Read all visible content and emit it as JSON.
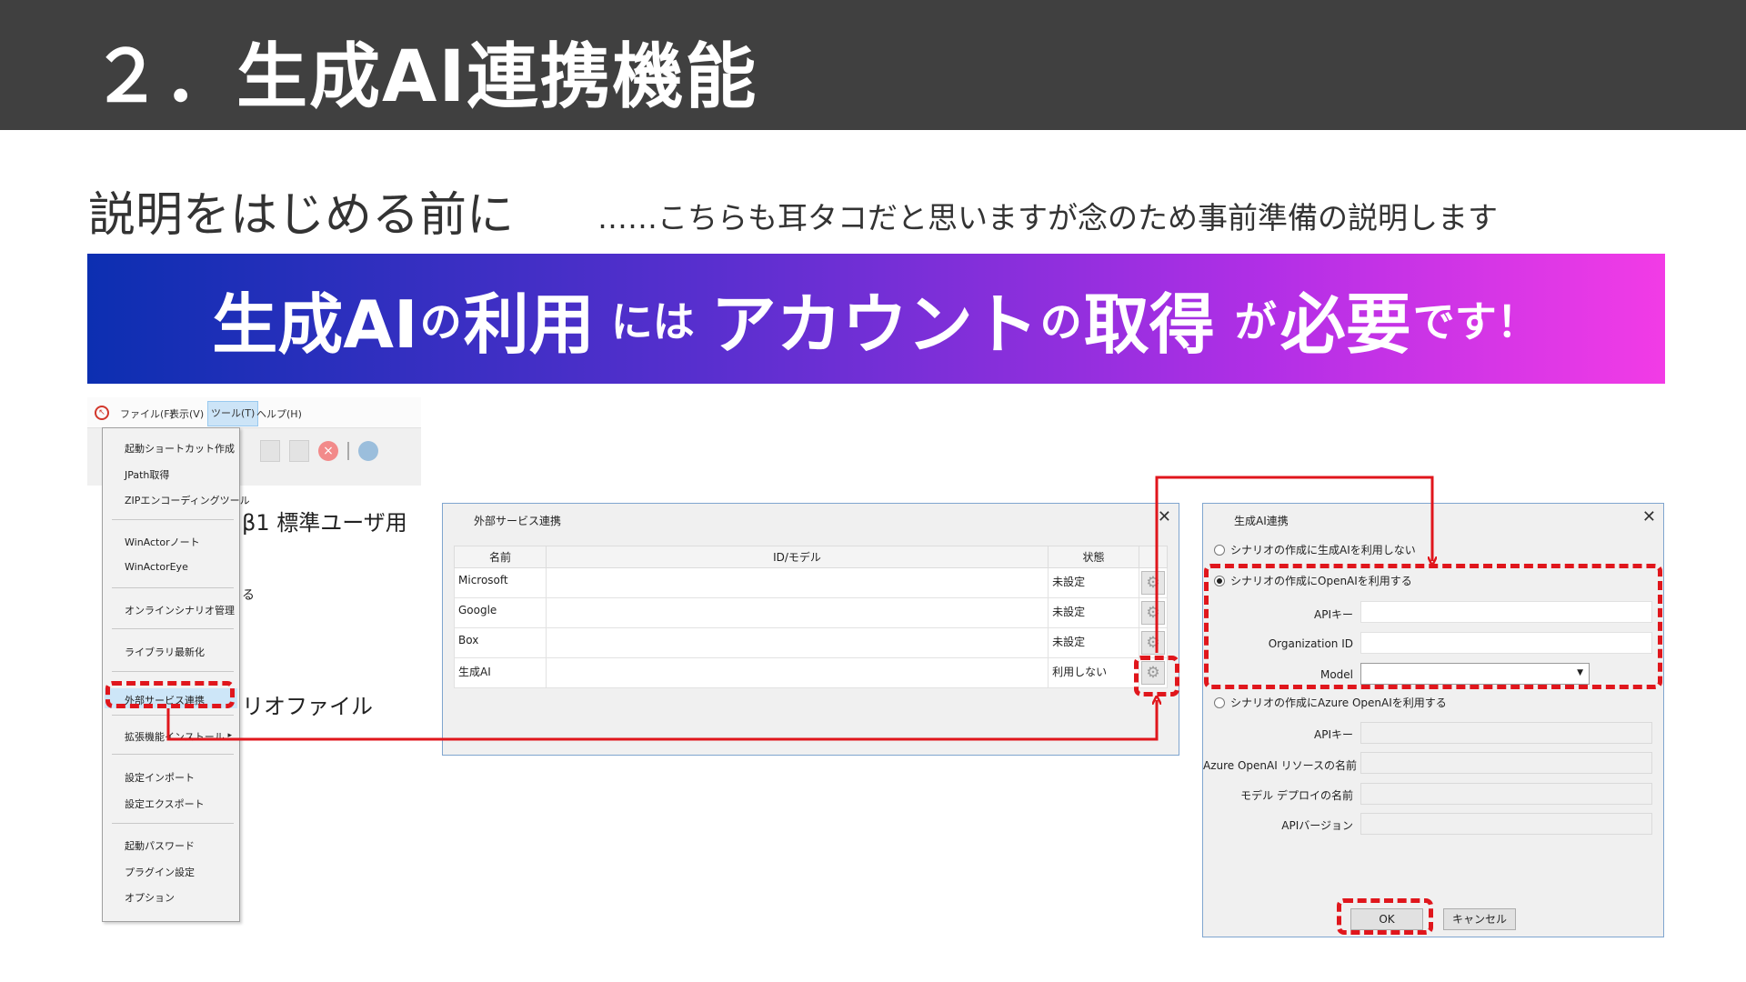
{
  "title": "２．生成AI連携機能",
  "subheading": "説明をはじめる前に",
  "subnote": "……こちらも耳タコだと思いますが念のため事前準備の説明します",
  "banner": {
    "part1": "生成AI",
    "part2": "の",
    "part3": "利用",
    "part4": "には",
    "part5": "アカウント",
    "part6": "の",
    "part7": "取得",
    "part8": "が",
    "part9": "必要",
    "part10": "です！"
  },
  "menu_window": {
    "menubar": [
      "ファイル(F)",
      "表示(V)",
      "ツール(T)",
      "ヘルプ(H)"
    ],
    "background_texts": [
      "β1 標準ユーザ用",
      "る",
      "リオファイル"
    ],
    "dropdown_items": [
      "起動ショートカット作成",
      "JPath取得",
      "ZIPエンコーディングツール",
      "WinActorノート",
      "WinActorEye",
      "オンラインシナリオ管理",
      "ライブラリ最新化",
      "外部サービス連携",
      "拡張機能インストール",
      "設定インポート",
      "設定エクスポート",
      "起動パスワード",
      "プラグイン設定",
      "オプション"
    ]
  },
  "ext_dialog": {
    "title": "外部サービス連携",
    "columns": [
      "名前",
      "ID/モデル",
      "状態"
    ],
    "rows": [
      {
        "name": "Microsoft",
        "id": "",
        "status": "未設定"
      },
      {
        "name": "Google",
        "id": "",
        "status": "未設定"
      },
      {
        "name": "Box",
        "id": "",
        "status": "未設定"
      },
      {
        "name": "生成AI",
        "id": "",
        "status": "利用しない"
      }
    ]
  },
  "ai_dialog": {
    "title": "生成AI連携",
    "option_none": "シナリオの作成に生成AIを利用しない",
    "option_openai": "シナリオの作成にOpenAIを利用する",
    "option_azure": "シナリオの作成にAzure OpenAIを利用する",
    "openai_fields": [
      "APIキー",
      "Organization ID",
      "Model"
    ],
    "azure_fields": [
      "APIキー",
      "Azure OpenAI リソースの名前",
      "モデル デプロイの名前",
      "APIバージョン"
    ],
    "ok_label": "OK",
    "cancel_label": "キャンセル"
  },
  "colors": {
    "title_bar": "#404040",
    "highlight_red": "#e0161c",
    "banner_start": "#0c2fb1",
    "banner_end": "#f23be6"
  }
}
